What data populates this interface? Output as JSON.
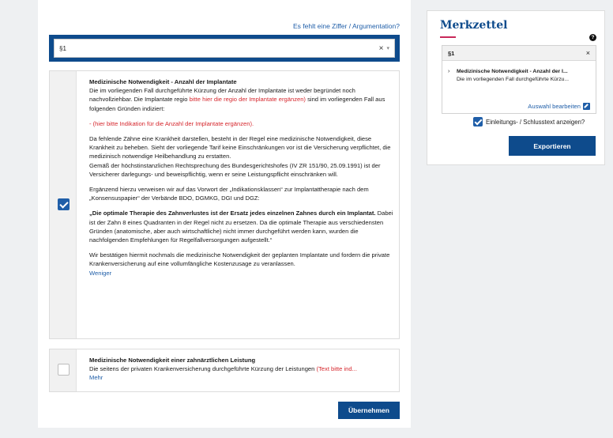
{
  "header": {
    "missing_link": "Es fehlt eine Ziffer / Argumentation?"
  },
  "select": {
    "value": "§1",
    "clear_icon": "×",
    "caret_icon": "▾"
  },
  "items": [
    {
      "checked": true,
      "title": "Medizinische Notwendigkeit - Anzahl der Implantate",
      "p1_a": "Die im vorliegenden Fall durchgeführte Kürzung der Anzahl der Implantate ist weder begründet noch nachvollziehbar. Die Implantate regio ",
      "p1_red": "bitte hier die regio der Implantate ergänzen)",
      "p1_b": " sind im vorliegenden Fall aus folgenden Gründen indiziert:",
      "p2_red": "- (hier bitte Indikation für die Anzahl der Implantate ergänzen).",
      "p3": "Da fehlende Zähne eine Krankheit darstellen, besteht in der Regel eine medizinische Notwendigkeit, diese Krankheit zu beheben. Sieht der vorliegende Tarif keine Einschränkungen vor ist die Versicherung verpflichtet, die medizinisch notwendige Heilbehandlung zu erstatten.",
      "p3b": "Gemäß der höchstinstanzlichen Rechtsprechung des Bundesgerichtshofes (IV ZR 151/90, 25.09.1991) ist der Versicherer darlegungs- und beweispflichtig, wenn er seine Leistungspflicht einschränken will.",
      "p4": "Ergänzend hierzu verweisen wir auf das Vorwort der „Indikationsklassen“ zur Implantattherapie nach dem „Konsensuspapier“ der Verbände BDO, DGMKG, DGI und DGZ:",
      "p5_bold": "„Die optimale Therapie des Zahnverlustes ist der Ersatz jedes einzelnen Zahnes durch ein Implantat.",
      "p5_rest": " Dabei ist der Zahn 8 eines Quadranten in der Regel nicht zu ersetzen. Da die optimale Therapie aus verschiedensten Gründen (anatomische, aber auch wirtschaftliche) nicht immer durchgeführt werden kann, wurden die nachfolgenden Empfehlungen für Regelfallversorgungen aufgestellt.“",
      "p6": "Wir bestätigen hiermit nochmals die medizinische Notwendigkeit der geplanten Implantate und fordern die private Krankenversicherung auf eine vollumfängliche Kostenzusage zu veranlassen.",
      "toggle": "Weniger"
    },
    {
      "checked": false,
      "title": "Medizinische Notwendigkeit einer zahnärztlichen Leistung",
      "text": "Die seitens der privaten Krankenversicherung durchgeführte Kürzung der Leistungen ",
      "text_red": "(Text bitte ind...",
      "toggle": "Mehr"
    }
  ],
  "apply_button": "Übernehmen",
  "merkzettel": {
    "title": "Merkzettel",
    "help_icon": "?",
    "box_head": "§1",
    "close_icon": "×",
    "entry_arrow": "›",
    "entry_title": "Medizinische Notwendigkeit - Anzahl der I...",
    "entry_text": "Die im vorliegenden Fall durchgeführte Kürzu...",
    "edit_label": "Auswahl bearbeiten",
    "option_label": "Einleitungs- / Schlusstext anzeigen?",
    "option_checked": true,
    "export_button": "Exportieren"
  },
  "colors": {
    "primary": "#0e4b8c",
    "link": "#1f5ea8",
    "placeholder_red": "#d6282e",
    "accent": "#c8285a"
  }
}
